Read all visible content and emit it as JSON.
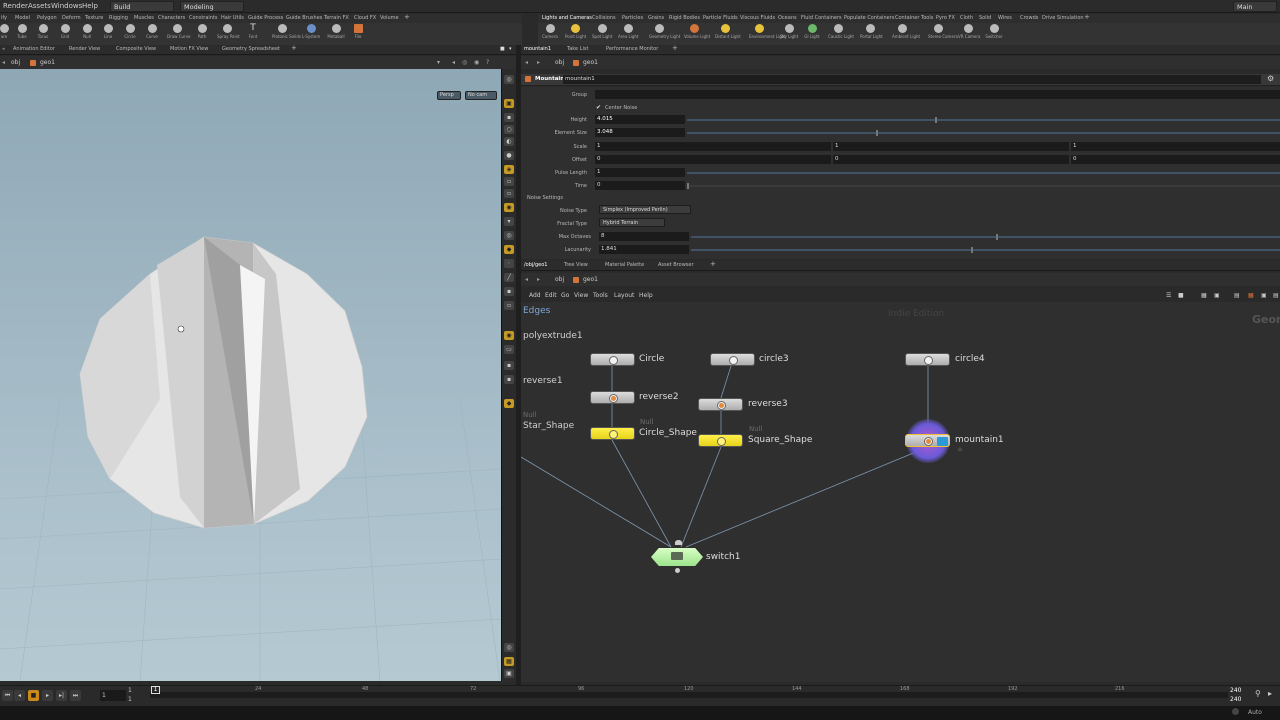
{
  "menubar": {
    "items": [
      "Render",
      "Assets",
      "Windows",
      "Help"
    ],
    "desktop": "Build",
    "context": "Modeling",
    "right": "Main"
  },
  "shelf_left": {
    "tabs": [
      "ify",
      "Model",
      "Polygon",
      "Deform",
      "Texture",
      "Rigging",
      "Muscles",
      "Characters",
      "Constraints",
      "Hair Utils",
      "Guide Process",
      "Guide Brushes",
      "Terrain FX",
      "Cloud FX",
      "Volume"
    ],
    "tools": [
      "are",
      "Tube",
      "Torus",
      "Grid",
      "Null",
      "Line",
      "Circle",
      "Curve",
      "Draw Curve",
      "Path",
      "Spray Paint",
      "Font",
      "Platonic Solids",
      "L-System",
      "Metaball",
      "File"
    ]
  },
  "shelf_right": {
    "tabs": [
      "Lights and Cameras",
      "Collisions",
      "Particles",
      "Grains",
      "Rigid Bodies",
      "Particle Fluids",
      "Viscous Fluids",
      "Oceans",
      "Fluid Containers",
      "Populate Containers",
      "Container Tools",
      "Pyro FX",
      "Cloth",
      "Solid",
      "Wires",
      "Crowds",
      "Drive Simulation"
    ],
    "tools": [
      "Camera",
      "Point Light",
      "Spot Light",
      "Area Light",
      "Geometry Light",
      "Volume Light",
      "Distant Light",
      "Environment Light",
      "Sky Light",
      "GI Light",
      "Caustic Light",
      "Portal Light",
      "Ambient Light",
      "Stereo Camera",
      "VR Camera",
      "Switcher"
    ]
  },
  "left_panel": {
    "tabs": [
      "Animation Editor",
      "Render View",
      "Composite View",
      "Motion FX View",
      "Geometry Spreadsheet"
    ],
    "path": [
      "obj",
      "geo1"
    ],
    "persp": "Persp",
    "cam": "No cam"
  },
  "right_panel": {
    "tabs": [
      "mountain1",
      "Take List",
      "Performance Monitor"
    ],
    "path": [
      "obj",
      "geo1"
    ]
  },
  "params": {
    "node_type": "Mountain",
    "node_name": "mountain1",
    "group_label": "Group",
    "center_noise": "Center Noise",
    "height_label": "Height",
    "height": "4.015",
    "element_size_label": "Element Size",
    "element_size": "3.048",
    "scale_label": "Scale",
    "scale": [
      "1",
      "1",
      "1"
    ],
    "offset_label": "Offset",
    "offset": [
      "0",
      "0",
      "0"
    ],
    "pulse_label": "Pulse Length",
    "pulse": "1",
    "time_label": "Time",
    "time": "0",
    "noise_settings": "Noise Settings",
    "noise_type_label": "Noise Type",
    "noise_type": "Simplex (Improved Perlin)",
    "fractal_type_label": "Fractal Type",
    "fractal_type": "Hybrid Terrain",
    "max_octaves_label": "Max Octaves",
    "max_octaves": "8",
    "lacunarity_label": "Lacunarity",
    "lacunarity": "1.841"
  },
  "network": {
    "tabs": [
      "/obj/geo1",
      "Tree View",
      "Material Palette",
      "Asset Browser"
    ],
    "path": [
      "obj",
      "geo1"
    ],
    "menu": [
      "Add",
      "Edit",
      "Go",
      "View",
      "Tools",
      "Layout",
      "Help"
    ],
    "edges_label": "Edges",
    "watermark": "Indie Edition",
    "context_label": "Geom",
    "nodes": {
      "polyextrude1": "polyextrude1",
      "reverse1": "reverse1",
      "star_null": "Null",
      "star_shape": "Star_Shape",
      "circle": "Circle",
      "circle3": "circle3",
      "circle4": "circle4",
      "reverse2": "reverse2",
      "reverse3": "reverse3",
      "circle_null": "Null",
      "circle_shape": "Circle_Shape",
      "square_null": "Null",
      "square_shape": "Square_Shape",
      "mountain1": "mountain1",
      "switch1": "switch1"
    }
  },
  "timeline": {
    "frame": "1",
    "start": "1",
    "start2": "1",
    "ticks": [
      "24",
      "48",
      "72",
      "96",
      "120",
      "144",
      "168",
      "192",
      "216"
    ],
    "end": "240",
    "end2": "240",
    "auto": "Auto"
  }
}
